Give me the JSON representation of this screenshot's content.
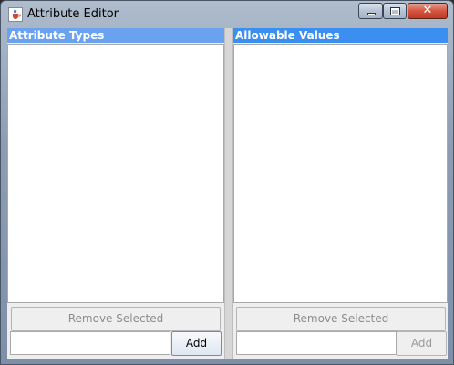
{
  "window": {
    "title": "Attribute Editor",
    "controls": {
      "minimize": "minimize-icon",
      "maximize": "maximize-icon",
      "close": "close-icon"
    }
  },
  "left_panel": {
    "header": "Attribute Types",
    "remove_label": "Remove Selected",
    "add_label": "Add",
    "input_value": ""
  },
  "right_panel": {
    "header": "Allowable Values",
    "remove_label": "Remove Selected",
    "add_label": "Add",
    "input_value": ""
  },
  "colors": {
    "left_header": "#6aa2f0",
    "right_header": "#3b8ff0",
    "disabled_text": "#8d8d8d"
  }
}
